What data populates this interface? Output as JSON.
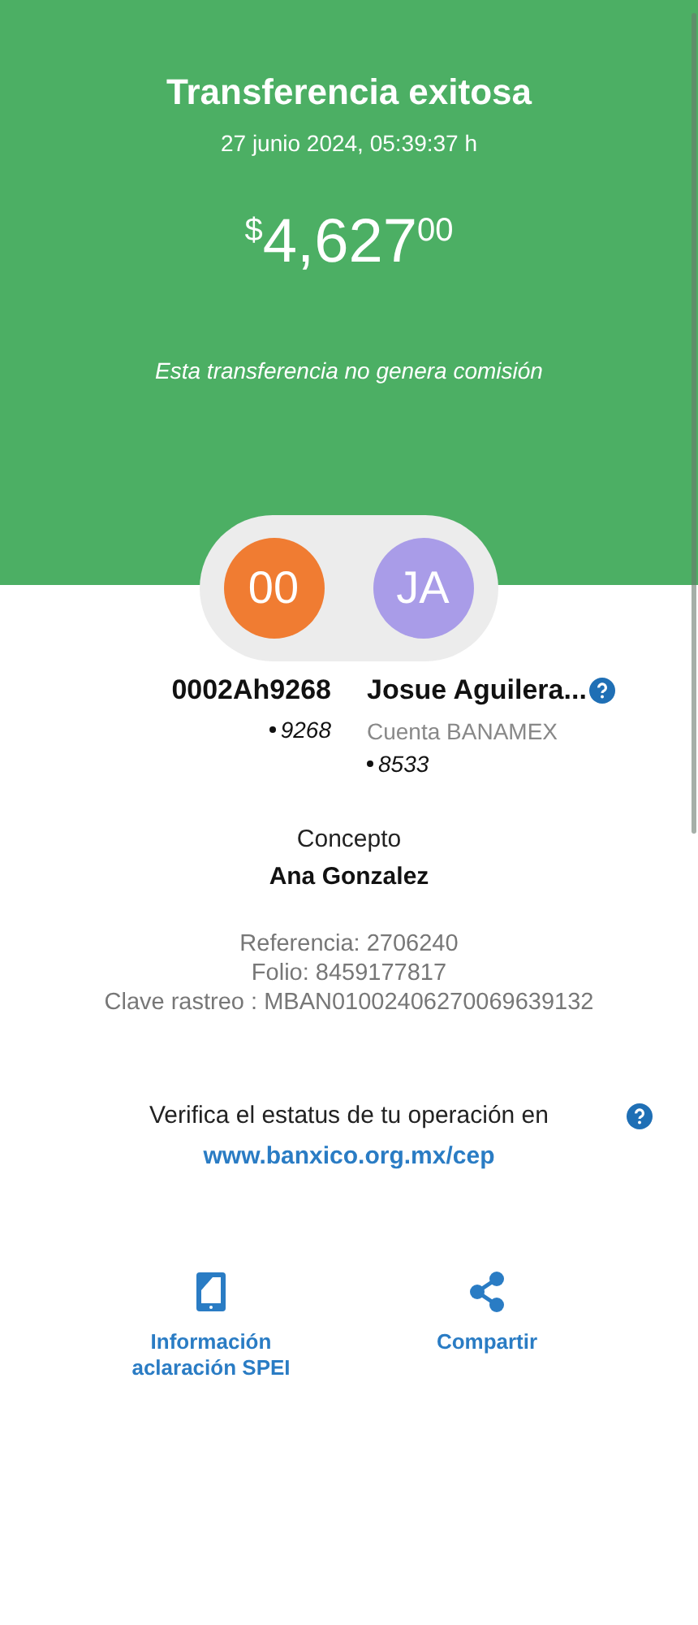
{
  "header": {
    "title": "Transferencia exitosa",
    "datetime": "27 junio 2024, 05:39:37 h",
    "amount": {
      "currency": "$",
      "integer": "4,627",
      "cents": "00"
    },
    "note": "Esta transferencia no genera comisión"
  },
  "sender": {
    "initials": "00",
    "color": "#f07c32",
    "name": "0002Ah9268",
    "account": "9268"
  },
  "receiver": {
    "initials": "JA",
    "color": "#a99ce8",
    "name": "Josue Aguilera...",
    "bank": "Cuenta BANAMEX",
    "account": "8533"
  },
  "concept": {
    "label": "Concepto",
    "value": "Ana Gonzalez"
  },
  "details": [
    "Referencia: 2706240",
    "Folio: 8459177817",
    "Clave rastreo : MBAN01002406270069639132"
  ],
  "verify": {
    "text": "Verifica el estatus de tu operación en",
    "link": "www.banxico.org.mx/cep"
  },
  "actions": [
    {
      "kind": "phone",
      "label": "Información aclaración SPEI"
    },
    {
      "kind": "share",
      "label": "Compartir"
    }
  ]
}
